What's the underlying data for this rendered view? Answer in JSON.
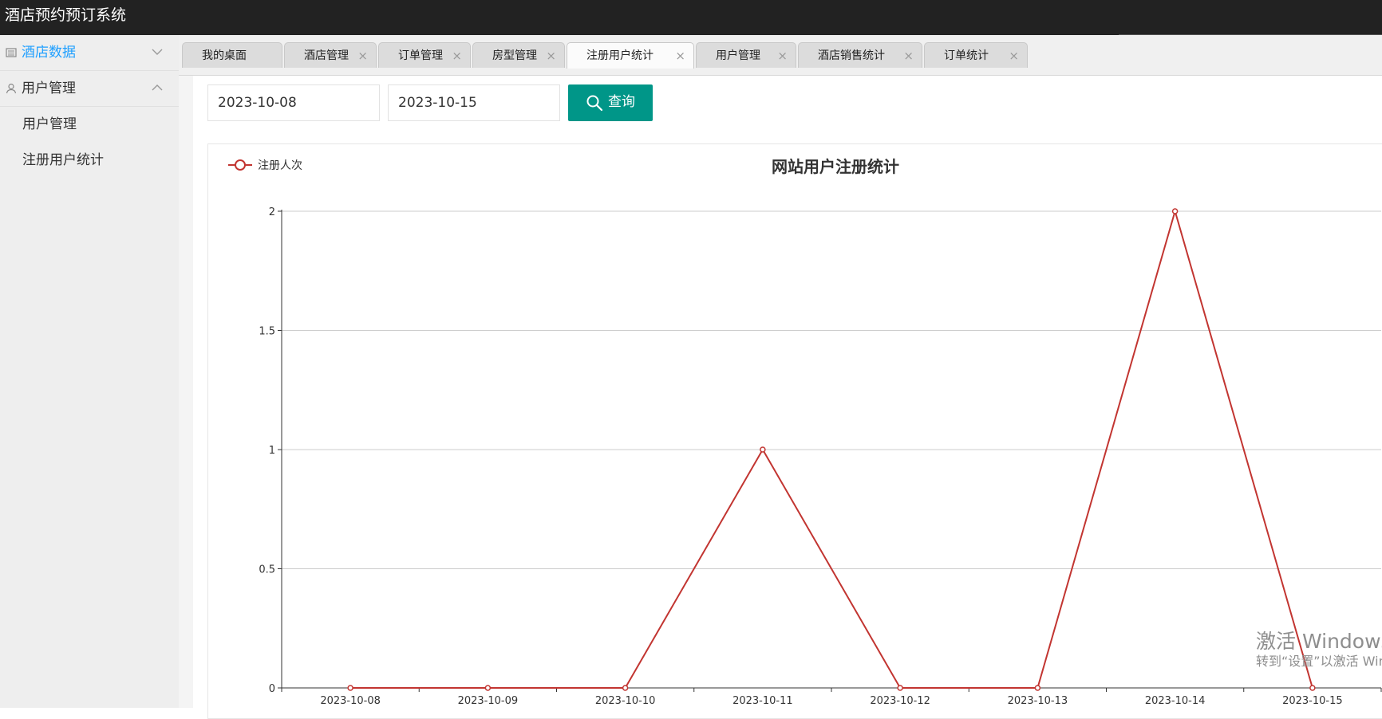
{
  "app": {
    "title": "酒店预约预订系统"
  },
  "sidebar": {
    "groups": [
      {
        "label": "酒店数据",
        "active": true
      },
      {
        "label": "用户管理",
        "active": false,
        "items": [
          "用户管理",
          "注册用户统计"
        ]
      }
    ]
  },
  "tabs": [
    {
      "label": "我的桌面",
      "closable": false
    },
    {
      "label": "酒店管理",
      "closable": true
    },
    {
      "label": "订单管理",
      "closable": true
    },
    {
      "label": "房型管理",
      "closable": true
    },
    {
      "label": "注册用户统计",
      "closable": true,
      "active": true
    },
    {
      "label": "用户管理",
      "closable": true
    },
    {
      "label": "酒店销售统计",
      "closable": true
    },
    {
      "label": "订单统计",
      "closable": true
    }
  ],
  "tab_close_glyph": "×",
  "filters": {
    "start_date": "2023-10-08",
    "end_date": "2023-10-15",
    "query_label": "查询"
  },
  "chart_data": {
    "type": "line",
    "title": "网站用户注册统计",
    "categories": [
      "2023-10-08",
      "2023-10-09",
      "2023-10-10",
      "2023-10-11",
      "2023-10-12",
      "2023-10-13",
      "2023-10-14",
      "2023-10-15"
    ],
    "series": [
      {
        "name": "注册人次",
        "values": [
          0,
          0,
          0,
          1,
          0,
          0,
          2,
          0
        ],
        "color": "#c23531"
      }
    ],
    "yticks": [
      0,
      0.5,
      1,
      1.5,
      2
    ],
    "ylim": [
      0,
      2
    ],
    "grid": true,
    "legend_position": "top-left"
  },
  "watermark": {
    "line1": "激活 Windows",
    "line2": "转到“设置”以激活 Windows。"
  },
  "colors": {
    "header_bg": "#222222",
    "accent_blue": "#1e9fff",
    "query_button": "#009688",
    "series_line": "#c23531"
  }
}
